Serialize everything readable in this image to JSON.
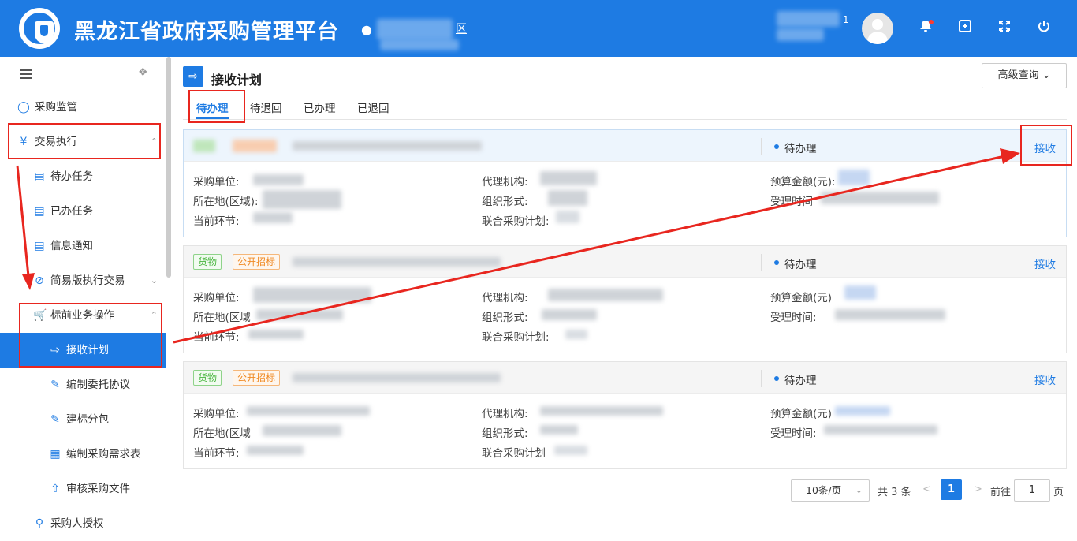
{
  "header": {
    "title": "黑龙江省政府采购管理平台",
    "location_icon": "map-pin-icon",
    "location_suffix": "区",
    "user_badge": "1",
    "icons": [
      "bell-icon",
      "window-icon",
      "fullscreen-icon",
      "power-icon"
    ]
  },
  "sidebar": {
    "items": [
      {
        "label": "采购监管",
        "icon": "shield-check-icon"
      },
      {
        "label": "交易执行",
        "icon": "clipboard-yen-icon",
        "expanded": true
      },
      {
        "label": "待办任务",
        "icon": "task-doc-icon"
      },
      {
        "label": "已办任务",
        "icon": "task-doc-icon"
      },
      {
        "label": "信息通知",
        "icon": "task-doc-icon"
      },
      {
        "label": "简易版执行交易",
        "icon": "circle-slash-icon"
      },
      {
        "label": "标前业务操作",
        "icon": "cart-icon",
        "expanded": true
      },
      {
        "label": "接收计划",
        "icon": "login-icon",
        "active": true
      },
      {
        "label": "编制委托协议",
        "icon": "edit-doc-icon"
      },
      {
        "label": "建标分包",
        "icon": "edit-doc-icon"
      },
      {
        "label": "编制采购需求表",
        "icon": "calendar-doc-icon"
      },
      {
        "label": "审核采购文件",
        "icon": "upload-doc-icon"
      },
      {
        "label": "采购人授权",
        "icon": "search-doc-icon"
      }
    ]
  },
  "page": {
    "title": "接收计划",
    "advanced_search": "高级查询"
  },
  "tabs": [
    "待办理",
    "待退回",
    "已办理",
    "已退回"
  ],
  "labels": {
    "purchaser": "采购单位:",
    "agency": "代理机构:",
    "budget": "预算金额(元):",
    "region": "所在地(区域):",
    "region_cut": "所在地(区域",
    "region_cut2": "所在地(区域",
    "org_form": "组织形式:",
    "accept_time": "受理时间:",
    "accept_time_cut": "受理时间",
    "stage": "当前环节:",
    "joint_plan": "联合采购计划:",
    "joint_plan_cut": "联合采购计划",
    "budget_cut": "预算金额(元)",
    "budget_cut2": "预算金额(元)"
  },
  "cards": [
    {
      "tags": [],
      "status": "待办理",
      "action": "接收"
    },
    {
      "tags": [
        "货物",
        "公开招标"
      ],
      "status": "待办理",
      "action": "接收"
    },
    {
      "tags": [
        "货物",
        "公开招标"
      ],
      "status": "待办理",
      "action": "接收"
    }
  ],
  "pagination": {
    "page_size": "10条/页",
    "total": "共 3 条",
    "prev": "<",
    "current": "1",
    "next": ">",
    "goto_label": "前往",
    "goto_value": "1",
    "page_suffix": "页"
  },
  "colors": {
    "primary": "#1e7be3",
    "annotation": "#e8261f"
  }
}
